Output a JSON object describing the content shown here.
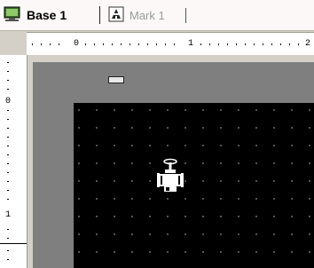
{
  "tabs": [
    {
      "label": "Base 1",
      "icon": "screen-icon",
      "active": true
    },
    {
      "label": "Mark 1",
      "icon": "mark-icon",
      "active": false
    }
  ],
  "ruler": {
    "h_labels": [
      "0",
      "1",
      "2"
    ],
    "v_labels": [
      "0",
      "1"
    ]
  },
  "object": {
    "icon": "valve-icon"
  },
  "colors": {
    "canvas": "#000000",
    "margin": "#7f7f7f",
    "tabbar": "#fbf8f7"
  }
}
